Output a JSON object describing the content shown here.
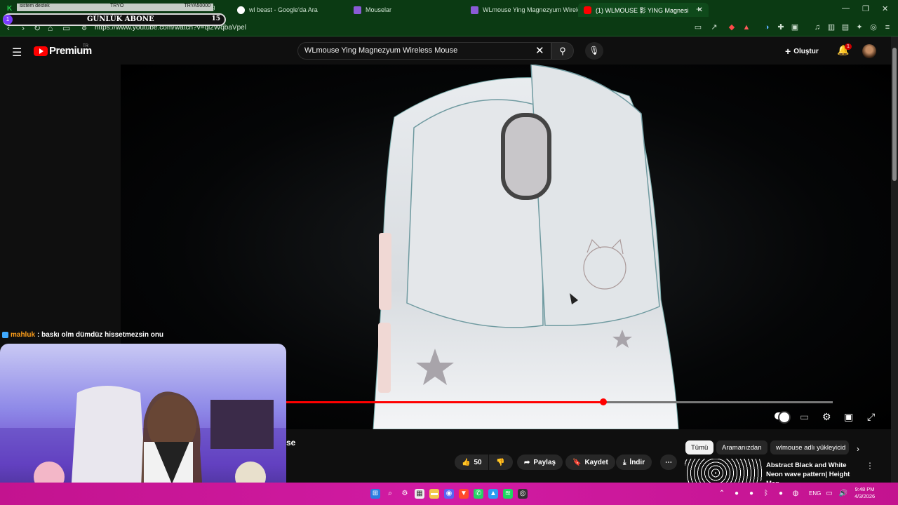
{
  "browser": {
    "tabs": [
      {
        "label": "sistem destek",
        "active": false
      },
      {
        "label": "wl beast - Google'da Ara",
        "active": false
      },
      {
        "label": "Mouselar",
        "active": false
      },
      {
        "label": "WLmouse Ying Magnezyum Wireless",
        "active": false
      },
      {
        "label": "(1) WLMOUSE 影 YING Magnesi",
        "active": true
      }
    ],
    "url": "https://www.youtube.com/watch?v=qi2WqbaVpel",
    "new_tab": "+",
    "close_tab": "✕"
  },
  "stream_overlay": {
    "bar_left": "sistem destek",
    "bar_mid": "TRYO",
    "bar_right": "TRYA50000",
    "bar_tail": "g",
    "goal_label": "GÜNLÜK ABONE",
    "goal_count": "15",
    "goal_dot": "1",
    "chat_user": "mahluk",
    "chat_message": ": baskı olm dümdüz hissetmezsin onu"
  },
  "youtube": {
    "brand": "Premium",
    "country": "TR",
    "search_value": "WLmouse Ying Magnezyum Wireless Mouse",
    "create_label": "Oluştur",
    "notification_count": "1",
    "title_fragment": "se",
    "actions": {
      "like_count": "50",
      "share": "Paylaş",
      "save": "Kaydet",
      "download": "İndir"
    },
    "chips": [
      "Tümü",
      "Aramanızdan",
      "wlmouse adlı yükleyicid"
    ],
    "recommendation": {
      "title": "Abstract Black and White Neon wave pattern| Height Map ..."
    },
    "progress_fraction": 0.58
  },
  "taskbar": {
    "lang": "ENG",
    "time": "9:48 PM",
    "date": "4/3/2026"
  },
  "colors": {
    "browser_bg": "#0b3a13",
    "yt_red": "#ff0000",
    "taskbar": "#c3138f"
  }
}
